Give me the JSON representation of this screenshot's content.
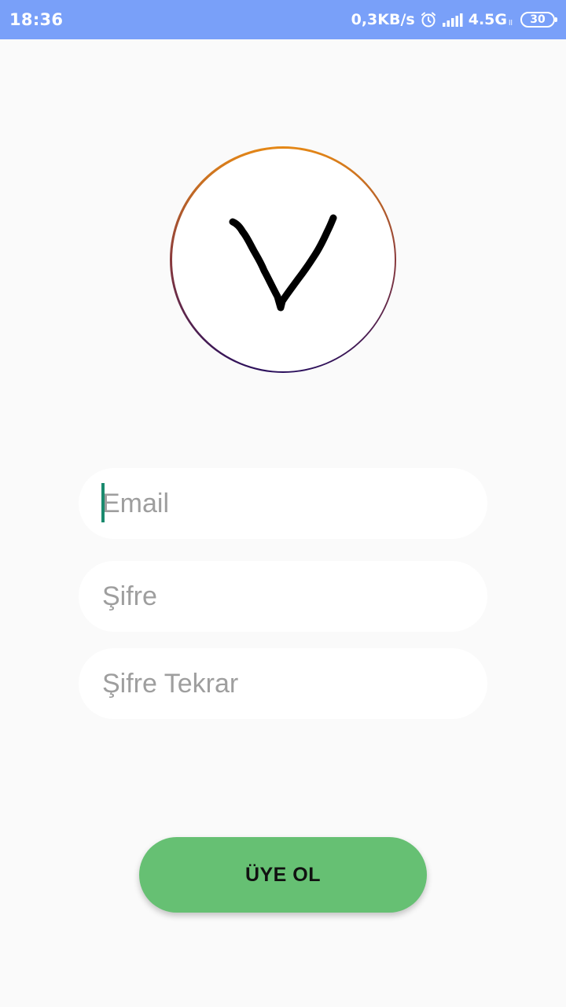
{
  "status_bar": {
    "time": "18:36",
    "network_speed": "0,3KB/s",
    "network_type": "4.5G",
    "network_sup": "ll",
    "battery": "30",
    "background_color": "#79a0f9"
  },
  "logo": {
    "icon": "v-logo-icon",
    "ring_gradient": [
      "#e58816",
      "#2a0f5c"
    ]
  },
  "form": {
    "email_placeholder": "Email",
    "email_value": "",
    "password_placeholder": "Şifre",
    "password_value": "",
    "password_repeat_placeholder": "Şifre Tekrar",
    "password_repeat_value": ""
  },
  "signup_button": {
    "label": "ÜYE OL",
    "color": "#66c073"
  }
}
